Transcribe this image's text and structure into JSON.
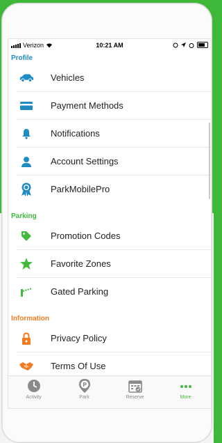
{
  "status_bar": {
    "carrier": "Verizon",
    "time": "10:21 AM"
  },
  "colors": {
    "profile": "#1f8bc3",
    "parking": "#40b93c",
    "information": "#f37b20"
  },
  "sections": {
    "profile": {
      "title": "Profile",
      "items": [
        {
          "label": "Vehicles",
          "icon": "car-icon"
        },
        {
          "label": "Payment Methods",
          "icon": "credit-card-icon"
        },
        {
          "label": "Notifications",
          "icon": "bell-icon"
        },
        {
          "label": "Account Settings",
          "icon": "user-icon"
        },
        {
          "label": "ParkMobilePro",
          "icon": "award-ribbon-icon"
        }
      ]
    },
    "parking": {
      "title": "Parking",
      "items": [
        {
          "label": "Promotion Codes",
          "icon": "tag-icon"
        },
        {
          "label": "Favorite Zones",
          "icon": "star-icon"
        },
        {
          "label": "Gated Parking",
          "icon": "gate-icon"
        }
      ]
    },
    "information": {
      "title": "Information",
      "items": [
        {
          "label": "Privacy Policy",
          "icon": "lock-icon"
        },
        {
          "label": "Terms Of Use",
          "icon": "handshake-icon"
        }
      ]
    }
  },
  "tabs": [
    {
      "label": "Activity",
      "icon": "clock-icon",
      "active": false
    },
    {
      "label": "Park",
      "icon": "parking-pin-icon",
      "active": false
    },
    {
      "label": "Reserve",
      "icon": "calendar-icon",
      "active": false
    },
    {
      "label": "More",
      "icon": "more-dots-icon",
      "active": true
    }
  ]
}
